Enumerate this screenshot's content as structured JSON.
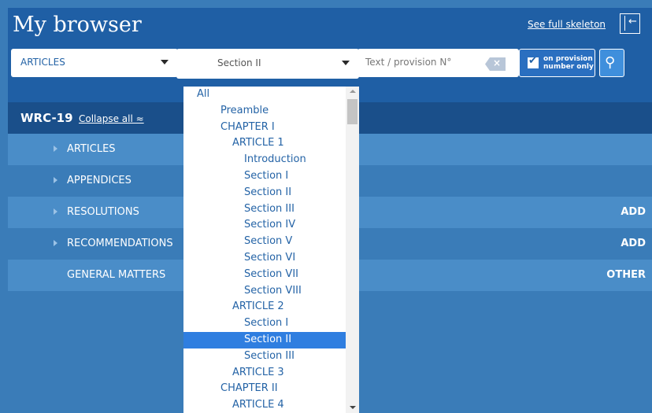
{
  "header": {
    "title": "My browser",
    "skeleton_link": "See full skeleton",
    "collapse_icon": "collapse-panel-icon"
  },
  "filters": {
    "type_select": "ARTICLES",
    "section_select": "Section II",
    "search_placeholder": "Text / provision N°",
    "provision_checkbox": {
      "checked": true,
      "label_line1": "on provision",
      "label_line2": "number only"
    },
    "search_icon": "search-icon"
  },
  "tree": {
    "root": "WRC-19",
    "collapse_all": "Collapse all ≈",
    "rows": [
      {
        "label": "ARTICLES",
        "action": ""
      },
      {
        "label": "APPENDICES",
        "action": ""
      },
      {
        "label": "RESOLUTIONS",
        "action": "ADD"
      },
      {
        "label": "RECOMMENDATIONS",
        "action": "ADD"
      },
      {
        "label": "GENERAL MATTERS",
        "action": "OTHER"
      }
    ]
  },
  "dropdown": {
    "items": [
      {
        "label": "All",
        "level": 0
      },
      {
        "label": "Preamble",
        "level": 1
      },
      {
        "label": "CHAPTER I",
        "level": 1
      },
      {
        "label": "ARTICLE 1",
        "level": 2
      },
      {
        "label": "Introduction",
        "level": 3
      },
      {
        "label": "Section I",
        "level": 3
      },
      {
        "label": "Section II",
        "level": 3
      },
      {
        "label": "Section III",
        "level": 3
      },
      {
        "label": "Section IV",
        "level": 3
      },
      {
        "label": "Section V",
        "level": 3
      },
      {
        "label": "Section VI",
        "level": 3
      },
      {
        "label": "Section VII",
        "level": 3
      },
      {
        "label": "Section VIII",
        "level": 3
      },
      {
        "label": "ARTICLE 2",
        "level": 2
      },
      {
        "label": "Section I",
        "level": 3
      },
      {
        "label": "Section II",
        "level": 3,
        "selected": true
      },
      {
        "label": "Section III",
        "level": 3
      },
      {
        "label": "ARTICLE 3",
        "level": 2
      },
      {
        "label": "CHAPTER II",
        "level": 1
      },
      {
        "label": "ARTICLE 4",
        "level": 2
      }
    ]
  }
}
